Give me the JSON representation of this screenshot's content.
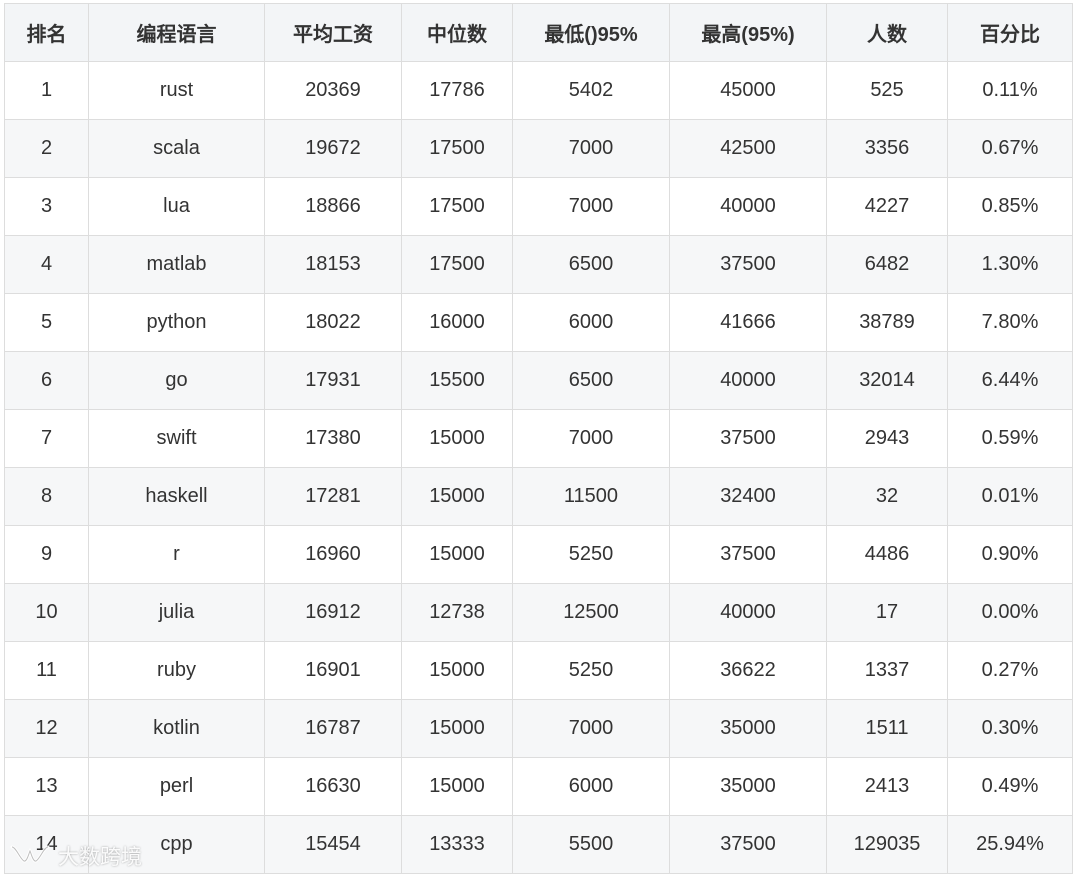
{
  "table": {
    "headers": [
      "排名",
      "编程语言",
      "平均工资",
      "中位数",
      "最低()95%",
      "最高(95%)",
      "人数",
      "百分比"
    ],
    "rows": [
      [
        "1",
        "rust",
        "20369",
        "17786",
        "5402",
        "45000",
        "525",
        "0.11%"
      ],
      [
        "2",
        "scala",
        "19672",
        "17500",
        "7000",
        "42500",
        "3356",
        "0.67%"
      ],
      [
        "3",
        "lua",
        "18866",
        "17500",
        "7000",
        "40000",
        "4227",
        "0.85%"
      ],
      [
        "4",
        "matlab",
        "18153",
        "17500",
        "6500",
        "37500",
        "6482",
        "1.30%"
      ],
      [
        "5",
        "python",
        "18022",
        "16000",
        "6000",
        "41666",
        "38789",
        "7.80%"
      ],
      [
        "6",
        "go",
        "17931",
        "15500",
        "6500",
        "40000",
        "32014",
        "6.44%"
      ],
      [
        "7",
        "swift",
        "17380",
        "15000",
        "7000",
        "37500",
        "2943",
        "0.59%"
      ],
      [
        "8",
        "haskell",
        "17281",
        "15000",
        "11500",
        "32400",
        "32",
        "0.01%"
      ],
      [
        "9",
        "r",
        "16960",
        "15000",
        "5250",
        "37500",
        "4486",
        "0.90%"
      ],
      [
        "10",
        "julia",
        "16912",
        "12738",
        "12500",
        "40000",
        "17",
        "0.00%"
      ],
      [
        "11",
        "ruby",
        "16901",
        "15000",
        "5250",
        "36622",
        "1337",
        "0.27%"
      ],
      [
        "12",
        "kotlin",
        "16787",
        "15000",
        "7000",
        "35000",
        "1511",
        "0.30%"
      ],
      [
        "13",
        "perl",
        "16630",
        "15000",
        "6000",
        "35000",
        "2413",
        "0.49%"
      ],
      [
        "14",
        "cpp",
        "15454",
        "13333",
        "5500",
        "37500",
        "129035",
        "25.94%"
      ]
    ]
  },
  "watermark": {
    "text": "大数跨境",
    "icon": "wechat-channel-icon"
  },
  "colors": {
    "header_bg": "#f3f5f7",
    "row_alt_bg": "#f6f7f8",
    "border": "#dddddd",
    "text": "#333333"
  }
}
